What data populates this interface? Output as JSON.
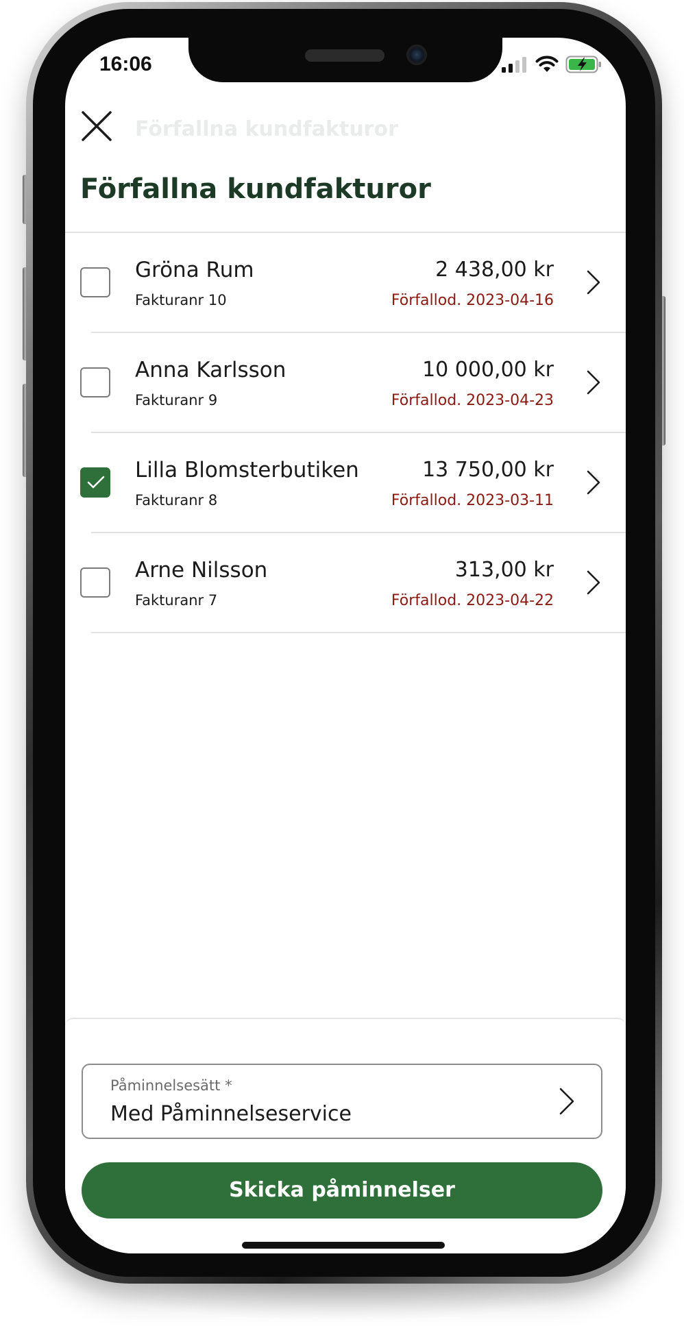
{
  "status_bar": {
    "time": "16:06",
    "icons": [
      "cellular-signal-icon",
      "wifi-icon",
      "battery-charging-icon"
    ]
  },
  "header": {
    "close_icon": "close-icon",
    "collapsed_title": "Förfallna kundfakturor",
    "title": "Förfallna kundfakturor"
  },
  "invoices": [
    {
      "customer": "Gröna Rum",
      "invoice_number": "Fakturanr 10",
      "amount": "2 438,00 kr",
      "due": "Förfallod. 2023-04-16",
      "selected": true
    },
    {
      "customer": "Anna Karlsson",
      "invoice_number": "Fakturanr 9",
      "amount": "10 000,00 kr",
      "due": "Förfallod. 2023-04-23",
      "selected": false
    },
    {
      "customer": "Lilla Blomsterbutiken",
      "invoice_number": "Fakturanr 8",
      "amount": "13 750,00 kr",
      "due": "Förfallod. 2023-03-11",
      "selected": true
    },
    {
      "customer": "Arne Nilsson",
      "invoice_number": "Fakturanr 7",
      "amount": "313,00 kr",
      "due": "Förfallod. 2023-04-22",
      "selected": false
    }
  ],
  "reminder_method": {
    "label": "Påminnelsesätt *",
    "value": "Med Påminnelseservice"
  },
  "send_button": {
    "label": "Skicka påminnelser"
  },
  "colors": {
    "accent_green": "#2f6f39",
    "title_green": "#1d3a26",
    "overdue_red": "#8b1a12"
  }
}
